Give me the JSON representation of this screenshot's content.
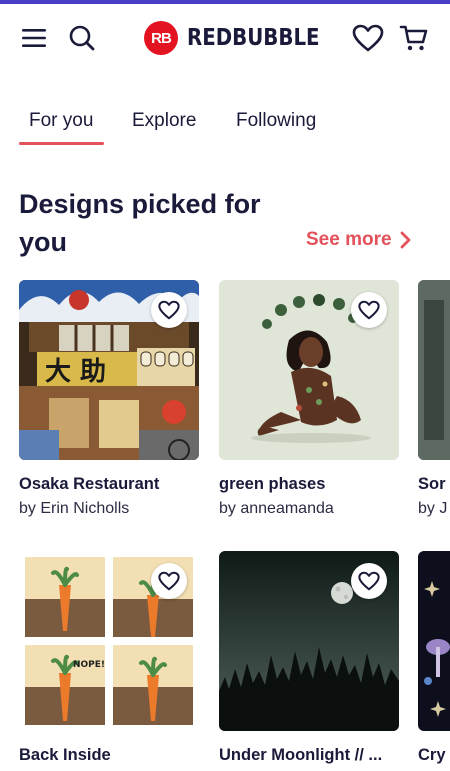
{
  "brand": {
    "logo_mark": "RB",
    "name": "REDBUBBLE",
    "accent_color": "#4a3fc4",
    "brand_red": "#e41321"
  },
  "header": {
    "icons": [
      "hamburger-menu-icon",
      "search-icon",
      "heart-icon",
      "cart-icon"
    ]
  },
  "tabs": [
    {
      "label": "For you",
      "active": true
    },
    {
      "label": "Explore",
      "active": false
    },
    {
      "label": "Following",
      "active": false
    }
  ],
  "section": {
    "title": "Designs picked for you",
    "see_more": "See more"
  },
  "designs": [
    {
      "title": "Osaka Restaurant",
      "artist": "by Erin Nicholls"
    },
    {
      "title": "green phases",
      "artist": "by anneamanda"
    },
    {
      "title": "Sor",
      "artist": "by J"
    },
    {
      "title": "Back Inside",
      "artist": ""
    },
    {
      "title": "Under Moonlight // ...",
      "artist": ""
    },
    {
      "title": "Cry",
      "artist": ""
    }
  ]
}
